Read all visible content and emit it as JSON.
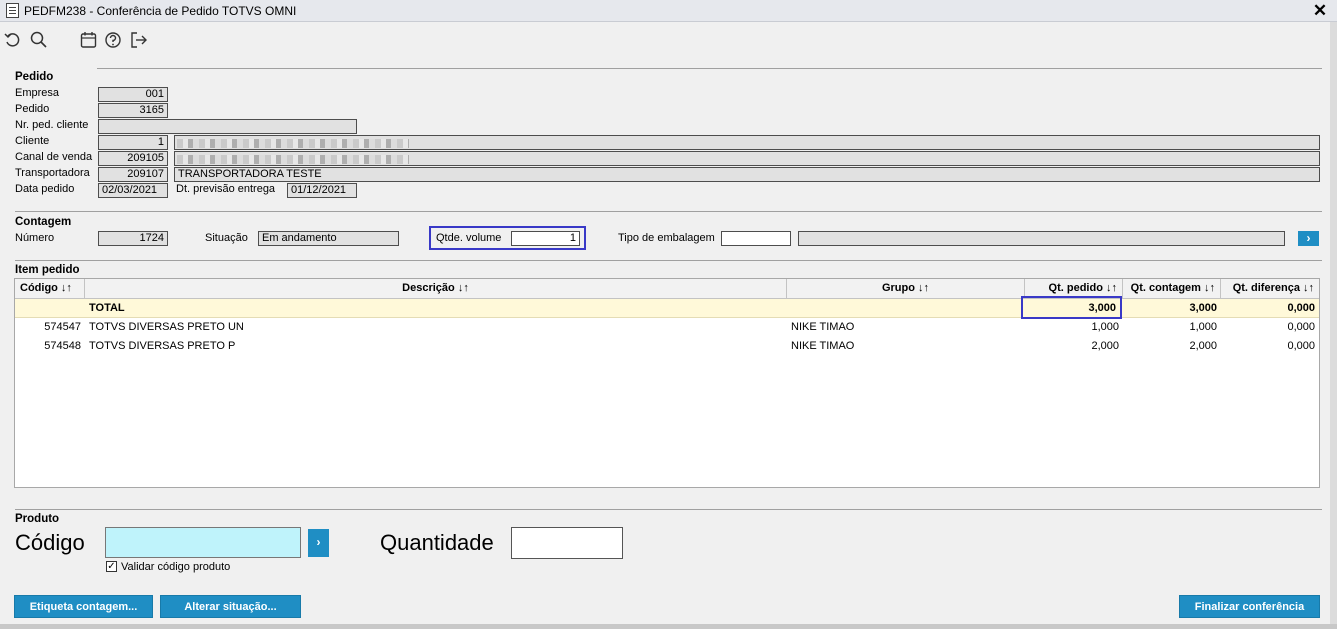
{
  "window": {
    "title": "PEDFM238 - Conferência de Pedido TOTVS OMNI",
    "close": "✕"
  },
  "toolbar": {
    "icons": [
      "undo-icon",
      "search-icon",
      "calendar-icon",
      "help-icon",
      "exit-icon"
    ]
  },
  "pedido": {
    "section": "Pedido",
    "empresa_label": "Empresa",
    "empresa": "001",
    "pedido_label": "Pedido",
    "pedido": "3165",
    "nr_ped_cliente_label": "Nr. ped. cliente",
    "nr_ped_cliente": "",
    "cliente_label": "Cliente",
    "cliente": "1",
    "canal_label": "Canal de venda",
    "canal": "209105",
    "transportadora_label": "Transportadora",
    "transportadora": "209107",
    "transportadora_nome": "TRANSPORTADORA TESTE",
    "data_label": "Data pedido",
    "data": "02/03/2021",
    "previsao_label": "Dt. previsão entrega",
    "previsao": "01/12/2021"
  },
  "contagem": {
    "section": "Contagem",
    "numero_label": "Número",
    "numero": "1724",
    "situacao_label": "Situação",
    "situacao": "Em andamento",
    "qtde_volume_label": "Qtde. volume",
    "qtde_volume": "1",
    "tipo_embalagem_label": "Tipo de embalagem",
    "tipo_embalagem": "",
    "go": "›"
  },
  "item_pedido": {
    "section": "Item pedido",
    "columns": [
      "Código ↓↑",
      "Descrição ↓↑",
      "Grupo ↓↑",
      "Qt. pedido ↓↑",
      "Qt. contagem ↓↑",
      "Qt. diferença ↓↑"
    ],
    "total": {
      "label": "TOTAL",
      "qt_pedido": "3,000",
      "qt_contagem": "3,000",
      "qt_diferenca": "0,000"
    },
    "rows": [
      {
        "codigo": "574547",
        "descricao": "TOTVS DIVERSAS PRETO UN",
        "grupo": "NIKE TIMAO",
        "qt_pedido": "1,000",
        "qt_contagem": "1,000",
        "qt_diferenca": "0,000"
      },
      {
        "codigo": "574548",
        "descricao": "TOTVS DIVERSAS PRETO P",
        "grupo": "NIKE TIMAO",
        "qt_pedido": "2,000",
        "qt_contagem": "2,000",
        "qt_diferenca": "0,000"
      }
    ]
  },
  "produto": {
    "section": "Produto",
    "codigo_label": "Código",
    "codigo": "",
    "quantidade_label": "Quantidade",
    "quantidade": "",
    "validar_label": "Validar código produto",
    "validar_checked": true,
    "go": "›"
  },
  "buttons": {
    "etiqueta": "Etiqueta contagem...",
    "alterar": "Alterar situação...",
    "finalizar": "Finalizar conferência"
  },
  "colors": {
    "accent": "#1f8ec4",
    "highlight": "#3939c7",
    "total_row": "#fff9d9",
    "codigo_input": "#bff3fb"
  }
}
